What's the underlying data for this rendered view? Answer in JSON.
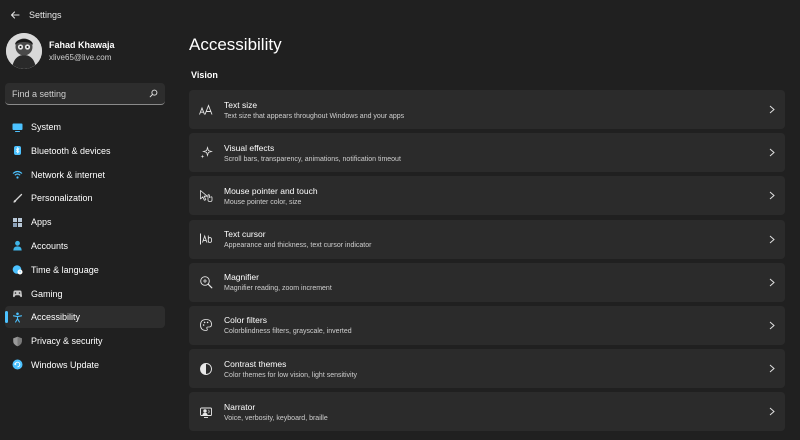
{
  "window": {
    "title": "Settings"
  },
  "profile": {
    "name": "Fahad Khawaja",
    "email": "xlive65@live.com"
  },
  "search": {
    "placeholder": "Find a setting"
  },
  "nav": {
    "items": [
      {
        "label": "System",
        "icon": "monitor-icon",
        "color": "#4cc2ff"
      },
      {
        "label": "Bluetooth & devices",
        "icon": "bluetooth-icon",
        "color": "#4cc2ff"
      },
      {
        "label": "Network & internet",
        "icon": "wifi-icon",
        "color": "#4cc2ff"
      },
      {
        "label": "Personalization",
        "icon": "brush-icon",
        "color": "#d8d8d8"
      },
      {
        "label": "Apps",
        "icon": "apps-icon",
        "color": "#a0b4c8"
      },
      {
        "label": "Accounts",
        "icon": "person-icon",
        "color": "#3fb5e8"
      },
      {
        "label": "Time & language",
        "icon": "globe-clock-icon",
        "color": "#4cc2ff"
      },
      {
        "label": "Gaming",
        "icon": "gamepad-icon",
        "color": "#c8c8c8"
      },
      {
        "label": "Accessibility",
        "icon": "accessibility-icon",
        "color": "#4cc2ff",
        "active": true
      },
      {
        "label": "Privacy & security",
        "icon": "shield-icon",
        "color": "#9a9a9a"
      },
      {
        "label": "Windows Update",
        "icon": "update-icon",
        "color": "#4cc2ff"
      }
    ]
  },
  "main": {
    "title": "Accessibility",
    "section": "Vision",
    "cards": [
      {
        "title": "Text size",
        "subtitle": "Text size that appears throughout Windows and your apps",
        "icon": "text-size-icon"
      },
      {
        "title": "Visual effects",
        "subtitle": "Scroll bars, transparency, animations, notification timeout",
        "icon": "sparkle-icon"
      },
      {
        "title": "Mouse pointer and touch",
        "subtitle": "Mouse pointer color, size",
        "icon": "pointer-icon"
      },
      {
        "title": "Text cursor",
        "subtitle": "Appearance and thickness, text cursor indicator",
        "icon": "text-cursor-icon"
      },
      {
        "title": "Magnifier",
        "subtitle": "Magnifier reading, zoom increment",
        "icon": "magnifier-icon"
      },
      {
        "title": "Color filters",
        "subtitle": "Colorblindness filters, grayscale, inverted",
        "icon": "palette-icon"
      },
      {
        "title": "Contrast themes",
        "subtitle": "Color themes for low vision, light sensitivity",
        "icon": "contrast-icon"
      },
      {
        "title": "Narrator",
        "subtitle": "Voice, verbosity, keyboard, braille",
        "icon": "narrator-icon"
      }
    ]
  }
}
